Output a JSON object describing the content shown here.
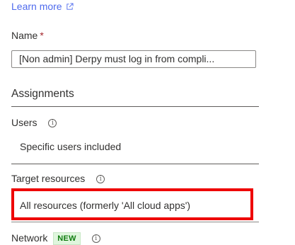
{
  "learn_more": {
    "label": "Learn more",
    "icon": "external-link-icon"
  },
  "name_field": {
    "label": "Name",
    "required_marker": "*",
    "value": "[Non admin] Derpy must log in from compli..."
  },
  "assignments": {
    "heading": "Assignments"
  },
  "users": {
    "label": "Users",
    "info_icon": "info-icon",
    "value": "Specific users included"
  },
  "target_resources": {
    "label": "Target resources",
    "info_icon": "info-icon",
    "value": "All resources (formerly 'All cloud apps')"
  },
  "network": {
    "label": "Network",
    "badge": "NEW",
    "info_icon": "info-icon"
  },
  "colors": {
    "link": "#4f6bed",
    "highlight": "#ee0000",
    "badge_bg": "#dff6dd",
    "badge_text": "#107c10",
    "required": "#a4262c"
  }
}
